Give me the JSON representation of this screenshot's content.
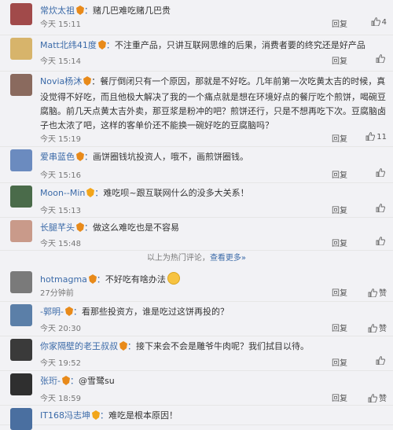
{
  "comments": [
    {
      "name": "常炊太祖",
      "text": "赌几巴难吃赌几巴贵",
      "time": "今天 15:11",
      "reply": "回复",
      "likes": "4",
      "avatar_color": "#a14a4a"
    },
    {
      "name": "Matt北纬41度",
      "text": "不注重产品，只讲互联网思维的后果，消费者要的终究还是好产品",
      "time": "今天 15:14",
      "reply": "回复",
      "likes": "",
      "avatar_color": "#d7b46b"
    },
    {
      "name": "Novia杨沐",
      "text": "餐厅倒闭只有一个原因，那就是不好吃。几年前第一次吃黄太吉的时候，真没觉得不好吃，而且他极大解决了我的一个痛点就是想在环境好点的餐厅吃个煎饼，喝碗豆腐脑。前几天点黄太吉外卖，那豆浆是粉冲的吧？煎饼还行，只是不想再吃下次。豆腐脑卤子也太浓了吧，这样的客单价还不能换一碗好吃的豆腐脑吗？",
      "time": "今天 15:19",
      "reply": "回复",
      "likes": "11",
      "avatar_color": "#8a6a5e"
    },
    {
      "name": "爱串蓝色",
      "text": "画饼圈钱坑投资人，哦不，画煎饼圈钱。",
      "time": "今天 15:16",
      "reply": "回复",
      "likes": "",
      "avatar_color": "#6b8bbf"
    },
    {
      "name": "Moon--Min",
      "text": "难吃呗~跟互联网什么的没多大关系！",
      "time": "今天 15:13",
      "reply": "回复",
      "likes": "",
      "avatar_color": "#4a6b4a"
    },
    {
      "name": "长腿芊头",
      "text": "做这么难吃也是不容易",
      "time": "今天 15:48",
      "reply": "回复",
      "likes": "",
      "avatar_color": "#c99a8a"
    },
    {
      "name": "hotmagma",
      "text": "不好吃有啥办法",
      "time": "27分钟前",
      "reply": "回复",
      "likes": "赞",
      "avatar_color": "#7a7a7a"
    },
    {
      "name": "-郭明-",
      "text": "看那些投资方，谁是吃过这饼再投的？",
      "time": "今天 20:30",
      "reply": "回复",
      "likes": "赞",
      "avatar_color": "#5b7fa8"
    },
    {
      "name": "你家隔壁的老王叔叔",
      "text": "接下来会不会是雕爷牛肉呢？我们拭目以待。",
      "time": "今天 19:52",
      "reply": "回复",
      "likes": "",
      "avatar_color": "#3a3a3a"
    },
    {
      "name": "张珩-",
      "text": "@雪鹭su",
      "time": "今天 18:59",
      "reply": "回复",
      "likes": "赞",
      "avatar_color": "#2f2f2f"
    },
    {
      "name": "IT168冯志坤",
      "text": "难吃是根本原因！",
      "time": "",
      "reply": "",
      "likes": "",
      "avatar_color": "#4a6fa0"
    }
  ],
  "divider": {
    "text": "以上为热门评论，",
    "link": "查看更多»"
  }
}
